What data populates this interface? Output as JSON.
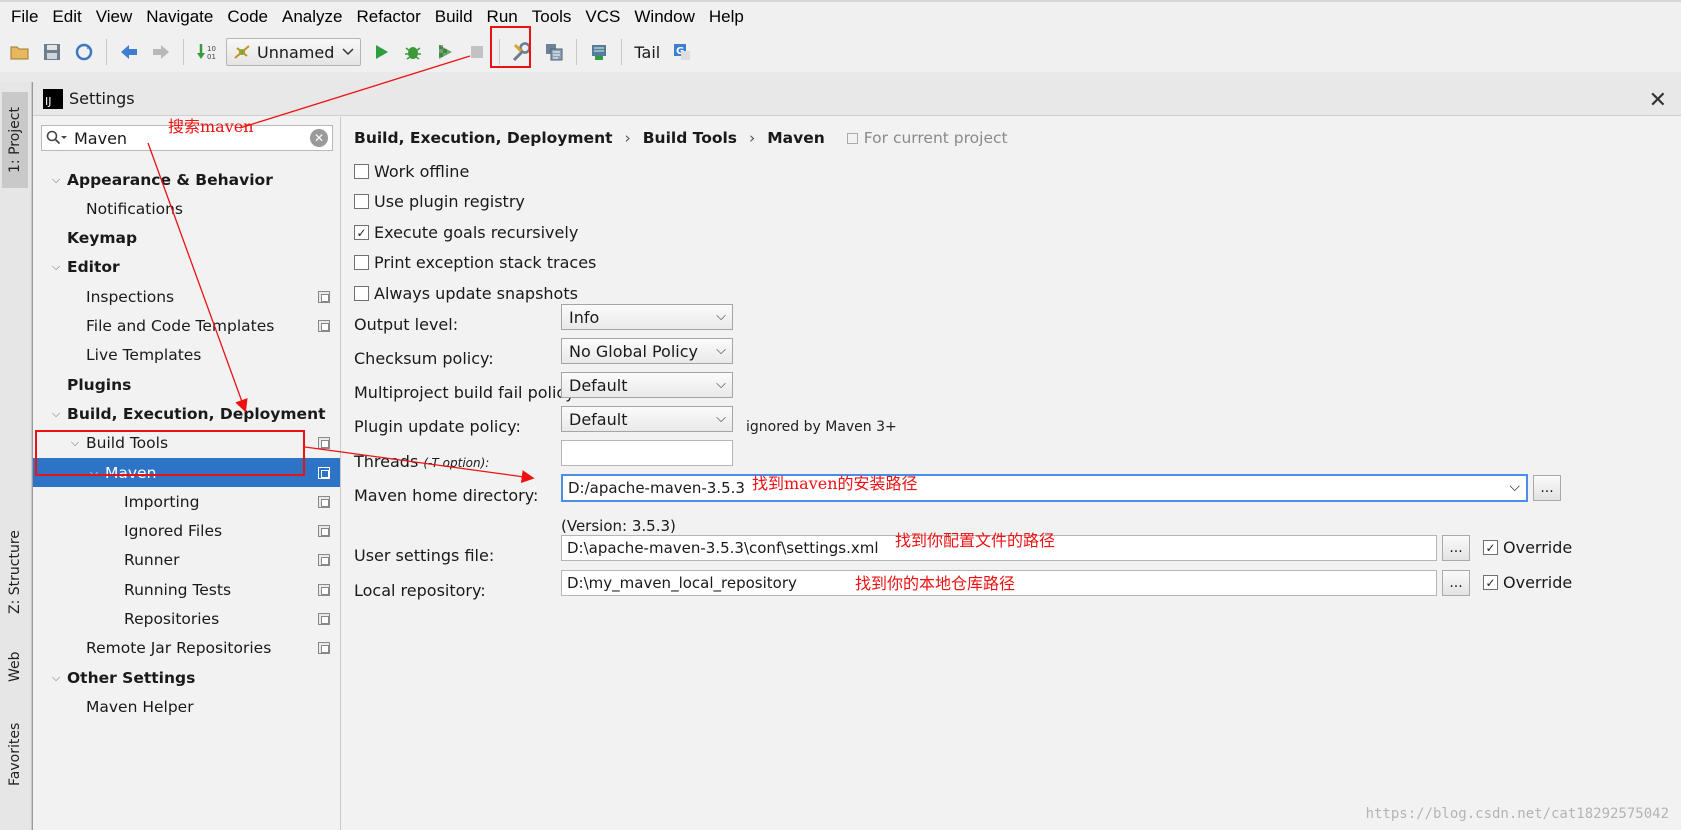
{
  "menu": [
    "File",
    "Edit",
    "View",
    "Navigate",
    "Code",
    "Analyze",
    "Refactor",
    "Build",
    "Run",
    "Tools",
    "VCS",
    "Window",
    "Help"
  ],
  "toolbar": {
    "run_config": "Unnamed",
    "tail_label": "Tail"
  },
  "tool_windows": {
    "project": "1: Project",
    "structure": "Z: Structure",
    "web": "Web",
    "favorites": "Favorites"
  },
  "dialog": {
    "title": "Settings",
    "search_value": "Maven",
    "tree": [
      {
        "label": "Appearance & Behavior",
        "level": 0,
        "bold": true,
        "expanded": true
      },
      {
        "label": "Notifications",
        "level": 1
      },
      {
        "label": "Keymap",
        "level": 0,
        "bold": true
      },
      {
        "label": "Editor",
        "level": 0,
        "bold": true,
        "expanded": true
      },
      {
        "label": "Inspections",
        "level": 1,
        "copy": true
      },
      {
        "label": "File and Code Templates",
        "level": 1,
        "copy": true
      },
      {
        "label": "Live Templates",
        "level": 1
      },
      {
        "label": "Plugins",
        "level": 0,
        "bold": true
      },
      {
        "label": "Build, Execution, Deployment",
        "level": 0,
        "bold": true,
        "expanded": true
      },
      {
        "label": "Build Tools",
        "level": 1,
        "expanded": true,
        "copy": true
      },
      {
        "label": "Maven",
        "level": 2,
        "expanded": true,
        "copy": true,
        "selected": true
      },
      {
        "label": "Importing",
        "level": 3,
        "copy": true
      },
      {
        "label": "Ignored Files",
        "level": 3,
        "copy": true
      },
      {
        "label": "Runner",
        "level": 3,
        "copy": true
      },
      {
        "label": "Running Tests",
        "level": 3,
        "copy": true
      },
      {
        "label": "Repositories",
        "level": 3,
        "copy": true
      },
      {
        "label": "Remote Jar Repositories",
        "level": 1,
        "copy": true
      },
      {
        "label": "Other Settings",
        "level": 0,
        "bold": true,
        "expanded": true
      },
      {
        "label": "Maven Helper",
        "level": 1
      }
    ],
    "breadcrumb": [
      "Build, Execution, Deployment",
      "Build Tools",
      "Maven"
    ],
    "scope": "For current project",
    "checkboxes": [
      {
        "label": "Work offline",
        "checked": false
      },
      {
        "label": "Use plugin registry",
        "checked": false
      },
      {
        "label": "Execute goals recursively",
        "checked": true
      },
      {
        "label": "Print exception stack traces",
        "checked": false
      },
      {
        "label": "Always update snapshots",
        "checked": false
      }
    ],
    "output_level": {
      "label": "Output level:",
      "value": "Info"
    },
    "checksum_policy": {
      "label": "Checksum policy:",
      "value": "No Global Policy"
    },
    "fail_policy": {
      "label": "Multiproject build fail policy:",
      "value": "Default"
    },
    "plugin_update": {
      "label": "Plugin update policy:",
      "value": "Default",
      "hint": "ignored by Maven 3+"
    },
    "threads": {
      "label": "Threads",
      "hint": "(-T option):",
      "value": ""
    },
    "maven_home": {
      "label": "Maven home directory:",
      "value": "D:/apache-maven-3.5.3",
      "version": "(Version: 3.5.3)"
    },
    "user_settings": {
      "label": "User settings file:",
      "value": "D:\\apache-maven-3.5.3\\conf\\settings.xml",
      "override": "Override"
    },
    "local_repo": {
      "label": "Local repository:",
      "value": "D:\\my_maven_local_repository",
      "override": "Override"
    },
    "browse_label": "..."
  },
  "annotations": {
    "search": "搜索maven",
    "home": "找到maven的安装路径",
    "settings": "找到你配置文件的路径",
    "repo": "找到你的本地仓库路径"
  },
  "watermark": "https://blog.csdn.net/cat18292575042",
  "colors": {
    "selection": "#2d74c6",
    "annotation": "#e11111",
    "focus": "#4b8ee8"
  }
}
